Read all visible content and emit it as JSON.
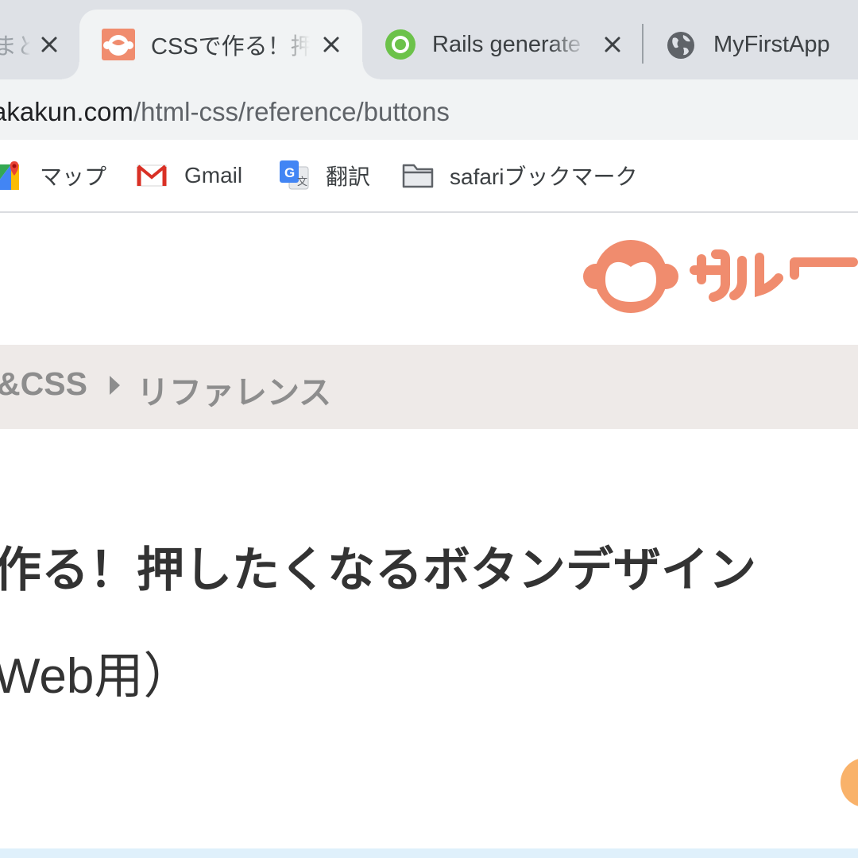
{
  "tabs": [
    {
      "title": "まと",
      "favicon": "page-icon",
      "active": false
    },
    {
      "title": "CSSで作る！押",
      "favicon": "saru-monkey-icon",
      "active": true
    },
    {
      "title": "Rails generate",
      "favicon": "rails-icon",
      "active": false
    },
    {
      "title": "MyFirstApp",
      "favicon": "globe-icon",
      "active": false
    }
  ],
  "address_bar": {
    "host": "akakun.com",
    "path": "/html-css/reference/buttons"
  },
  "bookmarks": [
    {
      "label": "マップ",
      "icon": "google-maps-icon"
    },
    {
      "label": "Gmail",
      "icon": "gmail-icon"
    },
    {
      "label": "翻訳",
      "icon": "google-translate-icon"
    },
    {
      "label": "safariブックマーク",
      "icon": "folder-icon"
    }
  ],
  "site": {
    "logo_icon": "saru-monkey-logo",
    "brand_color": "#f08c6e"
  },
  "breadcrumb": {
    "parent": "&CSS",
    "current": "リファレンス"
  },
  "article": {
    "title_line1": "作る！押したくなるボタンデザイン",
    "title_line2": "Web用）"
  },
  "colors": {
    "tabstrip": "#dee1e6",
    "toolbar": "#f1f3f4",
    "breadcrumb_bg": "#eeeae8",
    "heading": "#333333",
    "rails_green": "#6cc24a"
  }
}
